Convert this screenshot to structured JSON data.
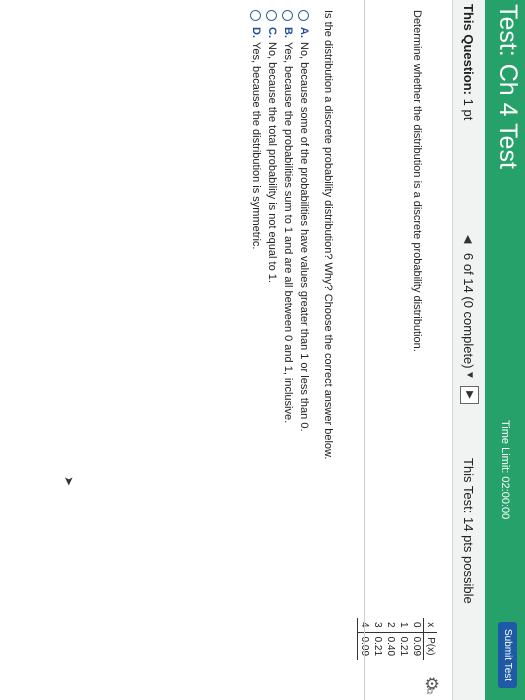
{
  "header": {
    "title": "Test: Ch 4 Test",
    "time_limit": "Time Limit: 02:00:00",
    "submit_label": "Submit Test"
  },
  "info_bar": {
    "this_question_label": "This Question:",
    "this_question_value": "1 pt",
    "progress": "6 of 14 (0 complete)",
    "this_test": "This Test: 14 pts possible"
  },
  "content": {
    "prompt": "Determine whether the distribution is a discrete probability distribution.",
    "table": {
      "headers": [
        "x",
        "P(x)"
      ],
      "rows": [
        [
          "0",
          "0.09"
        ],
        [
          "1",
          "0.21"
        ],
        [
          "2",
          "0.40"
        ],
        [
          "3",
          "0.21"
        ],
        [
          "4",
          "0.09"
        ]
      ]
    },
    "question": "Is the distribution a discrete probability distribution? Why? Choose the correct answer below.",
    "options": [
      {
        "letter": "A.",
        "text": "No, because some of the probabilities have values greater than 1 or less than 0."
      },
      {
        "letter": "B.",
        "text": "Yes, because the probabilities sum to 1 and are all between 0 and 1, inclusive."
      },
      {
        "letter": "C.",
        "text": "No, because the total probability is not equal to 1."
      },
      {
        "letter": "D.",
        "text": "Yes, because the distribution is symmetric."
      }
    ]
  },
  "icons": {
    "settings": "gear-icon",
    "copy_table": "copy-icon",
    "prev": "triangle-left-icon",
    "next": "triangle-right-icon"
  },
  "colors": {
    "banner": "#27a16a",
    "submit_button": "#1e5aa6",
    "option_letter": "#1e4f9a"
  }
}
